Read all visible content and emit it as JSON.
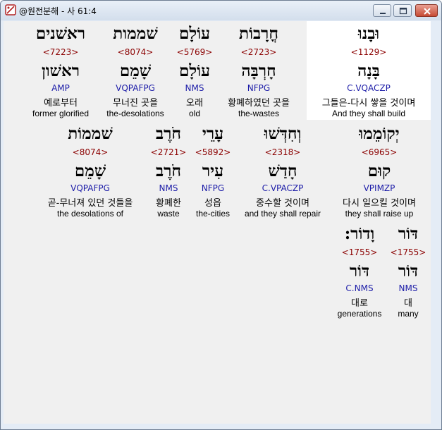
{
  "window": {
    "title": "@원전분해 - 사 61:4",
    "controls": {
      "minimize": "minimize",
      "maximize": "maximize",
      "close": "close"
    }
  },
  "rows": [
    [
      {
        "surface": "ראשׁנים",
        "strong": "<7223>",
        "lemma": "ראשׁון",
        "parse": "AMP",
        "korean": "예로부터",
        "english": "former glorified",
        "highlight": false
      },
      {
        "surface": "שׁממות",
        "strong": "<8074>",
        "lemma": "שָׁמֵם",
        "parse": "VQPAFPG",
        "korean": "무너진 곳을",
        "english": "the-desolations",
        "highlight": false
      },
      {
        "surface": "עוֹלָם",
        "strong": "<5769>",
        "lemma": "עוֹלָם",
        "parse": "NMS",
        "korean": "오래",
        "english": "old",
        "highlight": false
      },
      {
        "surface": "חֳרָבוֹת",
        "strong": "<2723>",
        "lemma": "חָרְבָּה",
        "parse": "NFPG",
        "korean": "황폐하였던 곳을",
        "english": "the-wastes",
        "highlight": false
      },
      {
        "surface": "וּבָנוּ",
        "strong": "<1129>",
        "lemma": "בָּנָה",
        "parse": "C.VQACZP",
        "korean": "그들은-다시 쌓을 것이며",
        "english": "And they shall build",
        "highlight": true
      }
    ],
    [
      {
        "surface": "שׁממוֹת",
        "strong": "<8074>",
        "lemma": "שָׁמֵם",
        "parse": "VQPAFPG",
        "korean": "곧-무너져 있던 것들을",
        "english": "the desolations of",
        "highlight": false
      },
      {
        "surface": "חֹרֶב",
        "strong": "<2721>",
        "lemma": "חֹרֶב",
        "parse": "NMS",
        "korean": "황폐한",
        "english": "waste",
        "highlight": false
      },
      {
        "surface": "עָרֵי",
        "strong": "<5892>",
        "lemma": "עִיר",
        "parse": "NFPG",
        "korean": "성읍",
        "english": "the-cities",
        "highlight": false
      },
      {
        "surface": "וְחִדְּשׁוּ",
        "strong": "<2318>",
        "lemma": "חָדַשׁ",
        "parse": "C.VPACZP",
        "korean": "중수할 것이며",
        "english": "and they shall repair",
        "highlight": false
      },
      {
        "surface": "יְקוֹמֵמוּ",
        "strong": "<6965>",
        "lemma": "קוּם",
        "parse": "VPIMZP",
        "korean": "다시 일으킬 것이며",
        "english": "they shall raise up",
        "highlight": false
      }
    ],
    [
      {
        "surface": "וָדוֹר:",
        "strong": "<1755>",
        "lemma": "דּוֹר",
        "parse": "C.NMS",
        "korean": "대로",
        "english": "generations",
        "highlight": false
      },
      {
        "surface": "דּוֹר",
        "strong": "<1755>",
        "lemma": "דּוֹר",
        "parse": "NMS",
        "korean": "대",
        "english": "many",
        "highlight": false
      }
    ]
  ]
}
